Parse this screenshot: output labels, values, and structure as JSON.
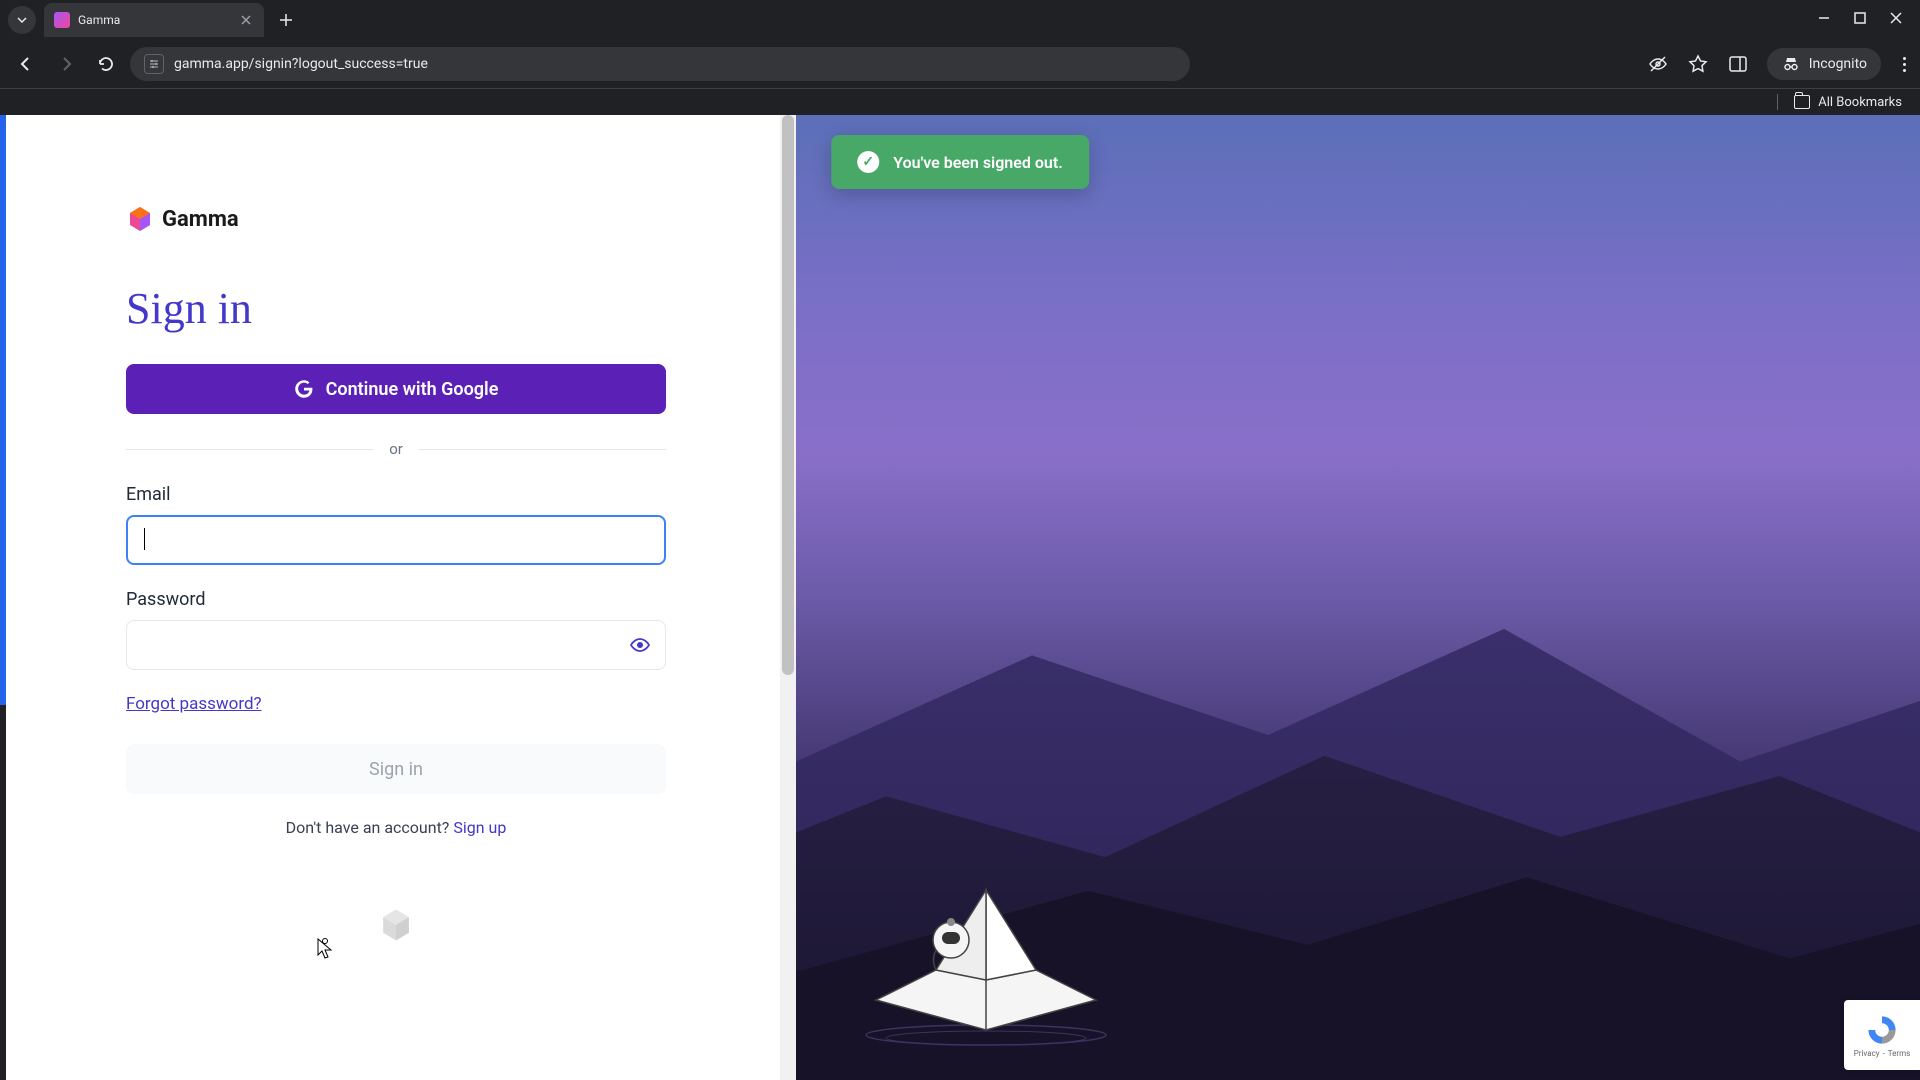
{
  "browser": {
    "tab_title": "Gamma",
    "url": "gamma.app/signin?logout_success=true",
    "incognito_label": "Incognito",
    "all_bookmarks": "All Bookmarks"
  },
  "toast": {
    "message": "You've been signed out."
  },
  "logo_text": "Gamma",
  "heading": "Sign in",
  "google_button": "Continue with Google",
  "divider_text": "or",
  "email_label": "Email",
  "email_value": "",
  "password_label": "Password",
  "password_value": "",
  "forgot_password": "Forgot password?",
  "signin_button": "Sign in",
  "no_account_text": "Don't have an account? ",
  "signup_link": "Sign up",
  "recaptcha": {
    "privacy": "Privacy",
    "terms": "Terms"
  },
  "colors": {
    "primary": "#5b21b6",
    "heading": "#4338ca",
    "toast_bg": "#48a868",
    "focus_border": "#3b82f6"
  }
}
